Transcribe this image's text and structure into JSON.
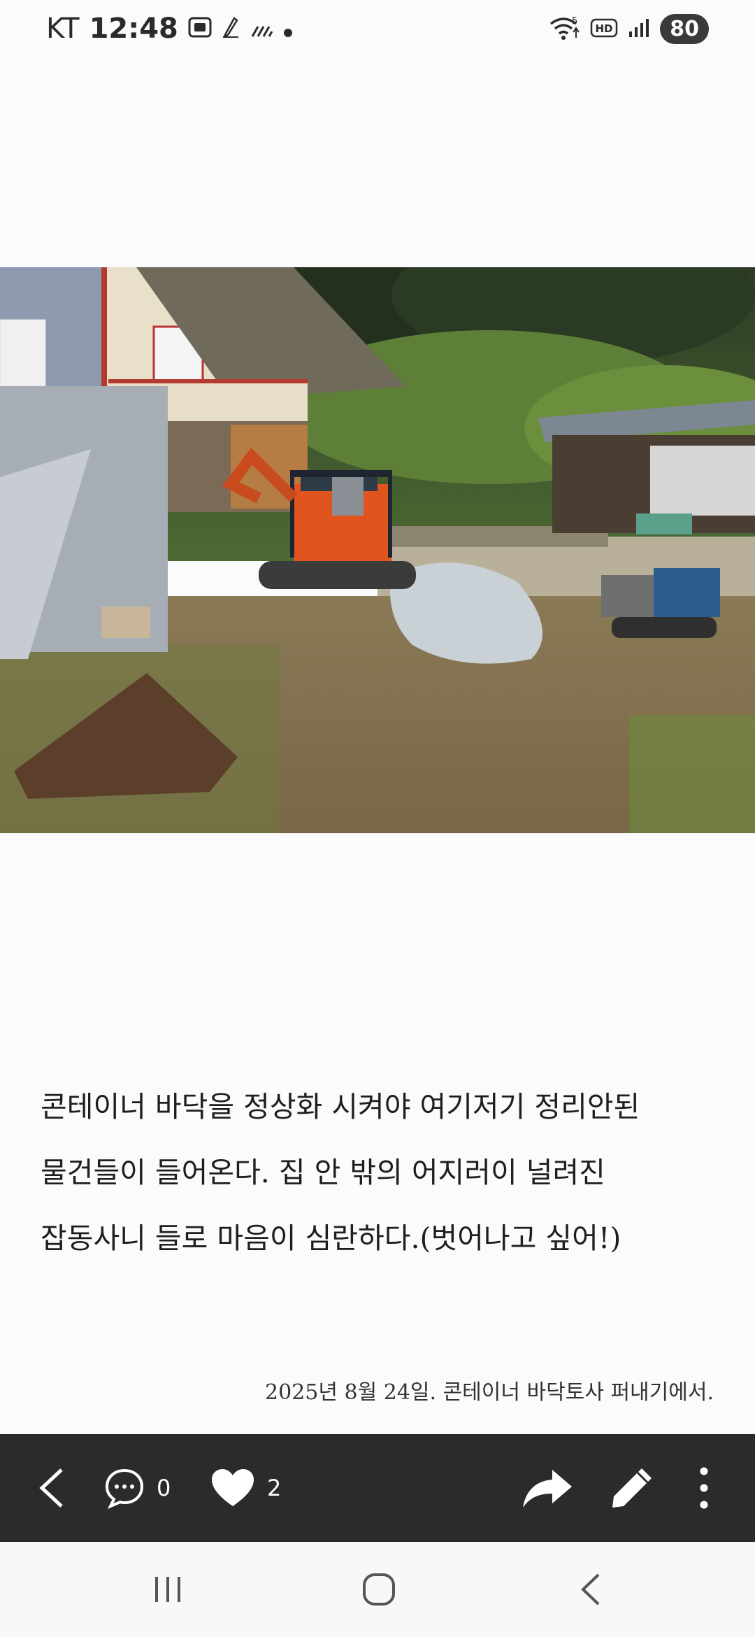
{
  "status_bar": {
    "carrier": "KT",
    "time": "12:48",
    "network_badge": "5",
    "hd_label": "HD",
    "battery": "80"
  },
  "photo": {
    "icon": "photo-excavator-yard"
  },
  "post": {
    "lines": [
      "콘테이너 바닥을 정상화 시켜야 여기저기 정리안된",
      "물건들이 들어온다.  집 안 밖의 어지러이 널려진",
      "잡동사니 들로 마음이 심란하다.(벗어나고 싶어!)"
    ],
    "caption": "2025년 8월 24일. 콘테이너 바닥토사 퍼내기에서."
  },
  "action_bar": {
    "comment_count": "0",
    "like_count": "2"
  },
  "colors": {
    "action_bar_bg": "#2b2b2b",
    "page_bg": "#fbfbfd"
  }
}
